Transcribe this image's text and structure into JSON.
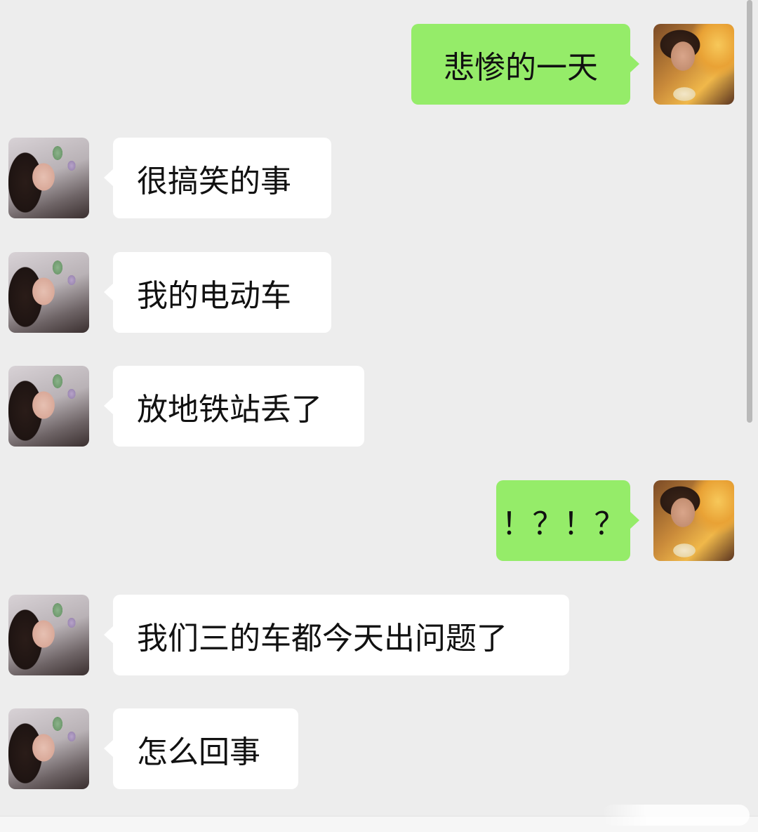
{
  "chat": {
    "messages": [
      {
        "sender": "self",
        "text": "悲惨的一天"
      },
      {
        "sender": "other",
        "text": "很搞笑的事"
      },
      {
        "sender": "other",
        "text": "我的电动车"
      },
      {
        "sender": "other",
        "text": "放地铁站丢了"
      },
      {
        "sender": "self",
        "text": "！？！？"
      },
      {
        "sender": "other",
        "text": "我们三的车都今天出问题了"
      },
      {
        "sender": "other",
        "text": "怎么回事"
      }
    ]
  },
  "colors": {
    "background": "#ededed",
    "self_bubble": "#95ec69",
    "other_bubble": "#ffffff",
    "text": "#111111"
  }
}
